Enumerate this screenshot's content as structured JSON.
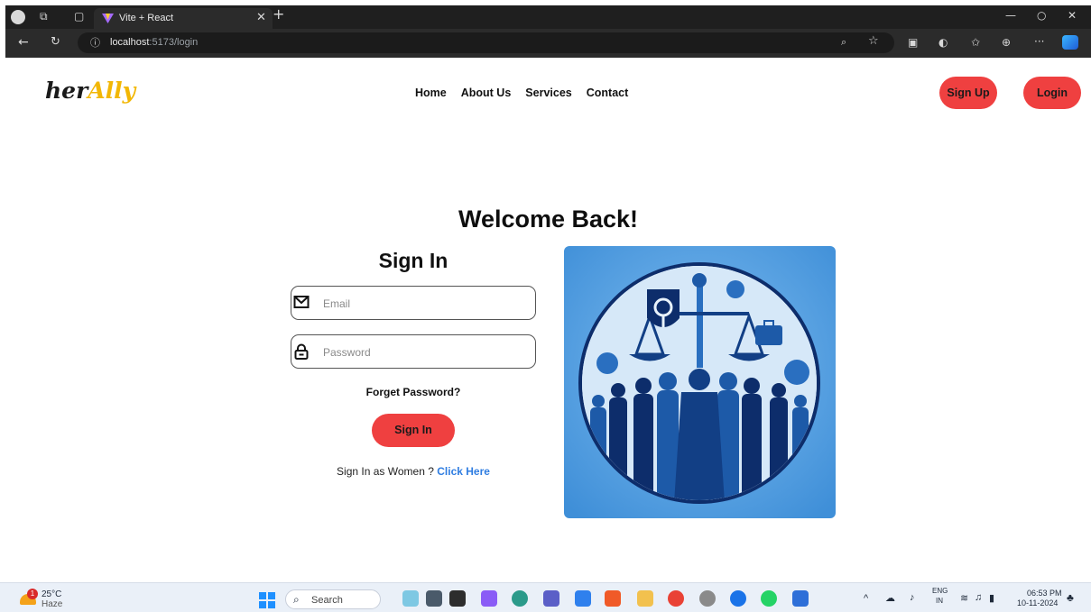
{
  "browser": {
    "tab_title": "Vite + React",
    "url_host": "localhost",
    "url_path": ":5173/login"
  },
  "header": {
    "logo_part1": "her",
    "logo_part2": "Ally",
    "nav": [
      "Home",
      "About Us",
      "Services",
      "Contact"
    ],
    "signup_label": "Sign Up",
    "login_label": "Login"
  },
  "main": {
    "welcome": "Welcome Back!",
    "form_title": "Sign In",
    "email_placeholder": "Email",
    "password_placeholder": "Password",
    "forget_label": "Forget Password?",
    "submit_label": "Sign In",
    "women_text": "Sign In as Women ?",
    "women_link": "Click Here"
  },
  "taskbar": {
    "temp": "25°C",
    "weather": "Haze",
    "weather_badge": "1",
    "search_placeholder": "Search",
    "lang_top": "ENG",
    "lang_bottom": "IN",
    "time": "06:53 PM",
    "date": "10-11-2024"
  },
  "colors": {
    "accent": "#ef4040",
    "link": "#2f7de1",
    "logo_yellow": "#f2b705"
  }
}
